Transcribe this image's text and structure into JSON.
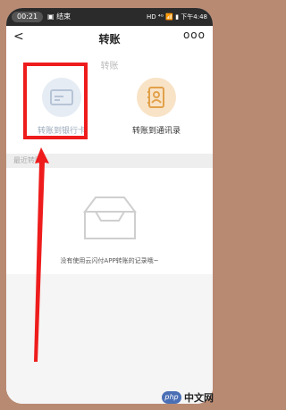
{
  "status_bar": {
    "time": "00:21",
    "message": "▣ 结束",
    "right_text": "HD ⁴ᴳ 📶 ▮ 下午4:48"
  },
  "nav": {
    "back_label": "<",
    "title": "转账",
    "more_label": "ooo"
  },
  "faded_title": "转账",
  "options": [
    {
      "label": "转账到银行卡",
      "icon": "bank-card-icon"
    },
    {
      "label": "转账到通讯录",
      "icon": "contacts-book-icon"
    }
  ],
  "recent_section": {
    "title": "最近转账",
    "empty_text": "没有使用云闪付APP转账的记录哦~",
    "empty_icon": "empty-tray-icon"
  },
  "annotation": {
    "highlight_color": "#ee1c1c"
  },
  "watermark": {
    "badge": "php",
    "text": "中文网"
  }
}
